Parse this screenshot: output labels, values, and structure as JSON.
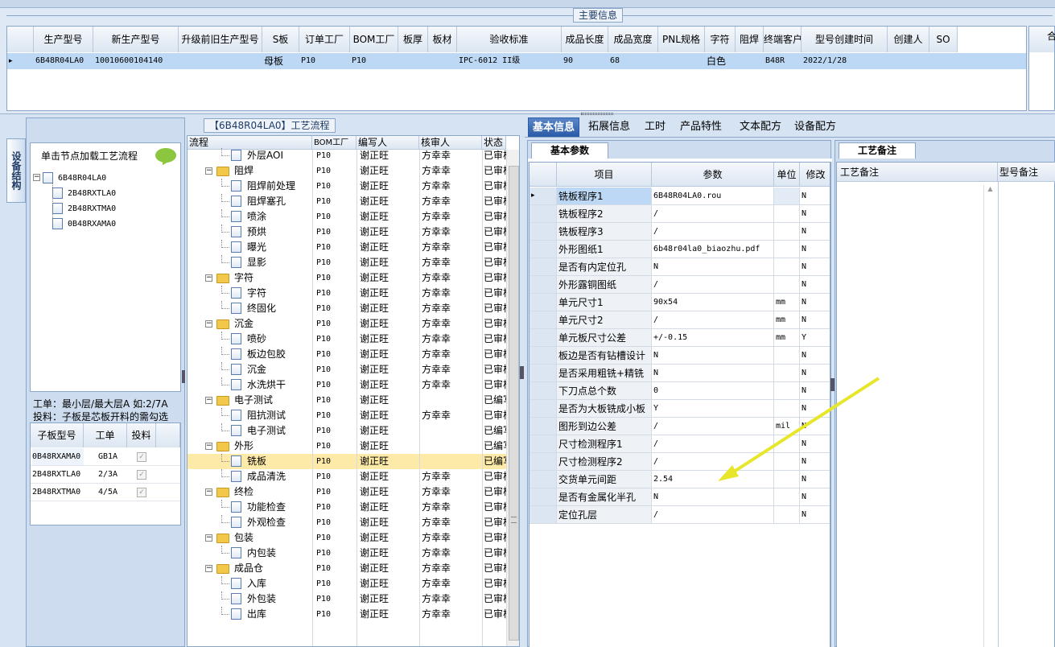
{
  "main_info": {
    "title": "主要信息",
    "columns": [
      "生产型号",
      "新生产型号",
      "升级前旧生产型号",
      "S板",
      "订单工厂",
      "BOM工厂",
      "板厚",
      "板材",
      "验收标准",
      "成品长度",
      "成品宽度",
      "PNL规格",
      "字符",
      "阻焊",
      "终端客户代码",
      "型号创建时间",
      "创建人",
      "SO"
    ],
    "row": [
      "6B48R04LA0",
      "10010600104140",
      "",
      "母板",
      "P10",
      "P10",
      "",
      "",
      "IPC-6012 II级",
      "90",
      "68",
      "",
      "白色",
      "",
      "B48R",
      "2022/1/28",
      "",
      ""
    ],
    "right_header": "合"
  },
  "left_tab": "设备结构",
  "left_panel": {
    "hint": "单击节点加载工艺流程",
    "tree": [
      "6B48R04LA0",
      "2B48RXTLA0",
      "2B48RXTMA0",
      "0B48RXAMA0"
    ],
    "info_line1": "工单：最小层/最大层A 如:2/7A",
    "info_line2": "投料：子板是芯板开料的需勾选",
    "sub_headers": [
      "子板型号",
      "工单",
      "投料"
    ],
    "sub_rows": [
      [
        "0B48RXAMA0",
        "GB1A"
      ],
      [
        "2B48RXTLA0",
        "2/3A"
      ],
      [
        "2B48RXTMA0",
        "4/5A"
      ]
    ]
  },
  "process": {
    "title": "【6B48R04LA0】工艺流程",
    "headers": [
      "流程",
      "BOM工厂",
      "编写人",
      "核审人",
      "状态"
    ],
    "rows": [
      {
        "type": "child",
        "name": "外层AOI",
        "bom": "P10",
        "writer": "谢正旺",
        "reviewer": "方幸幸",
        "status": "已审核"
      },
      {
        "type": "folder",
        "name": "阻焊",
        "bom": "P10",
        "writer": "谢正旺",
        "reviewer": "方幸幸",
        "status": "已审核"
      },
      {
        "type": "child",
        "name": "阻焊前处理",
        "bom": "P10",
        "writer": "谢正旺",
        "reviewer": "方幸幸",
        "status": "已审核"
      },
      {
        "type": "child",
        "name": "阻焊塞孔",
        "bom": "P10",
        "writer": "谢正旺",
        "reviewer": "方幸幸",
        "status": "已审核"
      },
      {
        "type": "child",
        "name": "喷涂",
        "bom": "P10",
        "writer": "谢正旺",
        "reviewer": "方幸幸",
        "status": "已审核"
      },
      {
        "type": "child",
        "name": "预烘",
        "bom": "P10",
        "writer": "谢正旺",
        "reviewer": "方幸幸",
        "status": "已审核"
      },
      {
        "type": "child",
        "name": "曝光",
        "bom": "P10",
        "writer": "谢正旺",
        "reviewer": "方幸幸",
        "status": "已审核"
      },
      {
        "type": "child",
        "name": "显影",
        "bom": "P10",
        "writer": "谢正旺",
        "reviewer": "方幸幸",
        "status": "已审核"
      },
      {
        "type": "folder",
        "name": "字符",
        "bom": "P10",
        "writer": "谢正旺",
        "reviewer": "方幸幸",
        "status": "已审核"
      },
      {
        "type": "child",
        "name": "字符",
        "bom": "P10",
        "writer": "谢正旺",
        "reviewer": "方幸幸",
        "status": "已审核"
      },
      {
        "type": "child",
        "name": "终固化",
        "bom": "P10",
        "writer": "谢正旺",
        "reviewer": "方幸幸",
        "status": "已审核"
      },
      {
        "type": "folder",
        "name": "沉金",
        "bom": "P10",
        "writer": "谢正旺",
        "reviewer": "方幸幸",
        "status": "已审核"
      },
      {
        "type": "child",
        "name": "喷砂",
        "bom": "P10",
        "writer": "谢正旺",
        "reviewer": "方幸幸",
        "status": "已审核"
      },
      {
        "type": "child",
        "name": "板边包胶",
        "bom": "P10",
        "writer": "谢正旺",
        "reviewer": "方幸幸",
        "status": "已审核"
      },
      {
        "type": "child",
        "name": "沉金",
        "bom": "P10",
        "writer": "谢正旺",
        "reviewer": "方幸幸",
        "status": "已审核"
      },
      {
        "type": "child",
        "name": "水洗烘干",
        "bom": "P10",
        "writer": "谢正旺",
        "reviewer": "方幸幸",
        "status": "已审核"
      },
      {
        "type": "folder",
        "name": "电子测试",
        "bom": "P10",
        "writer": "谢正旺",
        "reviewer": "",
        "status": "已编写"
      },
      {
        "type": "child",
        "name": "阻抗测试",
        "bom": "P10",
        "writer": "谢正旺",
        "reviewer": "方幸幸",
        "status": "已审核"
      },
      {
        "type": "child",
        "name": "电子测试",
        "bom": "P10",
        "writer": "谢正旺",
        "reviewer": "",
        "status": "已编写"
      },
      {
        "type": "folder",
        "name": "外形",
        "bom": "P10",
        "writer": "谢正旺",
        "reviewer": "",
        "status": "已编写"
      },
      {
        "type": "child",
        "name": "铣板",
        "bom": "P10",
        "writer": "谢正旺",
        "reviewer": "",
        "status": "已编写",
        "selected": true
      },
      {
        "type": "child",
        "name": "成品清洗",
        "bom": "P10",
        "writer": "谢正旺",
        "reviewer": "方幸幸",
        "status": "已审核"
      },
      {
        "type": "folder",
        "name": "终检",
        "bom": "P10",
        "writer": "谢正旺",
        "reviewer": "方幸幸",
        "status": "已审核"
      },
      {
        "type": "child",
        "name": "功能检查",
        "bom": "P10",
        "writer": "谢正旺",
        "reviewer": "方幸幸",
        "status": "已审核"
      },
      {
        "type": "child",
        "name": "外观检查",
        "bom": "P10",
        "writer": "谢正旺",
        "reviewer": "方幸幸",
        "status": "已审核"
      },
      {
        "type": "folder",
        "name": "包装",
        "bom": "P10",
        "writer": "谢正旺",
        "reviewer": "方幸幸",
        "status": "已审核"
      },
      {
        "type": "child",
        "name": "内包装",
        "bom": "P10",
        "writer": "谢正旺",
        "reviewer": "方幸幸",
        "status": "已审核"
      },
      {
        "type": "folder",
        "name": "成品仓",
        "bom": "P10",
        "writer": "谢正旺",
        "reviewer": "方幸幸",
        "status": "已审核"
      },
      {
        "type": "child",
        "name": "入库",
        "bom": "P10",
        "writer": "谢正旺",
        "reviewer": "方幸幸",
        "status": "已审核"
      },
      {
        "type": "child",
        "name": "外包装",
        "bom": "P10",
        "writer": "谢正旺",
        "reviewer": "方幸幸",
        "status": "已审核"
      },
      {
        "type": "child",
        "name": "出库",
        "bom": "P10",
        "writer": "谢正旺",
        "reviewer": "方幸幸",
        "status": "已审核"
      }
    ]
  },
  "tabs": [
    "基本信息",
    "拓展信息",
    "工时",
    "产品特性",
    "文本配方",
    "设备配方"
  ],
  "basic_params": {
    "title": "基本参数",
    "headers": [
      "项目",
      "参数",
      "单位",
      "修改"
    ],
    "rows": [
      [
        "铣板程序1",
        "6B48R04LA0.rou",
        "",
        "N"
      ],
      [
        "铣板程序2",
        "/",
        "",
        "N"
      ],
      [
        "铣板程序3",
        "/",
        "",
        "N"
      ],
      [
        "外形图纸1",
        "6b48r04la0_biaozhu.pdf",
        "",
        "N"
      ],
      [
        "是否有内定位孔",
        "N",
        "",
        "N"
      ],
      [
        "外形露铜图纸",
        "/",
        "",
        "N"
      ],
      [
        "单元尺寸1",
        "90x54",
        "mm",
        "N"
      ],
      [
        "单元尺寸2",
        "/",
        "mm",
        "N"
      ],
      [
        "单元板尺寸公差",
        "+/-0.15",
        "mm",
        "Y"
      ],
      [
        "板边是否有钻槽设计",
        "N",
        "",
        "N"
      ],
      [
        "是否采用粗铣+精铣",
        "N",
        "",
        "N"
      ],
      [
        "下刀点总个数",
        "0",
        "",
        "N"
      ],
      [
        "是否为大板铣成小板",
        "Y",
        "",
        "N"
      ],
      [
        "图形到边公差",
        "/",
        "mil",
        "N"
      ],
      [
        "尺寸检测程序1",
        "/",
        "",
        "N"
      ],
      [
        "尺寸检测程序2",
        "/",
        "",
        "N"
      ],
      [
        "交货单元间距",
        "2.54",
        "",
        "N"
      ],
      [
        "是否有金属化半孔",
        "N",
        "",
        "N"
      ],
      [
        "定位孔层",
        "/",
        "",
        "N"
      ]
    ]
  },
  "process_notes": {
    "title": "工艺备注",
    "col1": "工艺备注",
    "col2": "型号备注"
  },
  "colors": {
    "selected_row": "#fde9a8",
    "header_bg": "#dce6f2",
    "accent": "#1f3b66",
    "arrow": "#e7e62a"
  }
}
